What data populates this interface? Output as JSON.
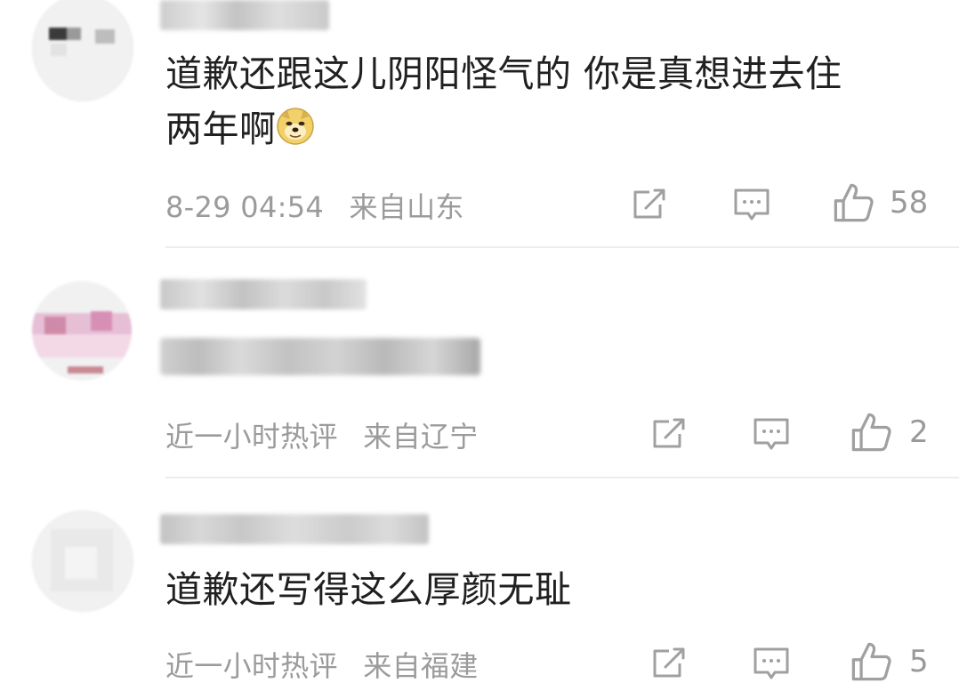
{
  "comments": [
    {
      "text_line1": "道歉还跟这儿阴阳怪气的 你是真想进去住",
      "text_line2": "两年啊",
      "emoji": "doge-emoji",
      "time": "8-29 04:54",
      "location": "来自山东",
      "likes": "58"
    },
    {
      "text": "",
      "time": "近一小时热评",
      "location": "来自辽宁",
      "likes": "2"
    },
    {
      "text": "道歉还写得这么厚颜无耻",
      "time": "近一小时热评",
      "location": "来自福建",
      "likes": "5"
    }
  ],
  "icons": {
    "forward": "share-icon",
    "reply": "comment-icon",
    "like": "thumbs-up-icon"
  },
  "colors": {
    "text": "#202020",
    "meta": "#9b9b9b",
    "icon": "#a0a0a0",
    "divider": "#ececec"
  }
}
